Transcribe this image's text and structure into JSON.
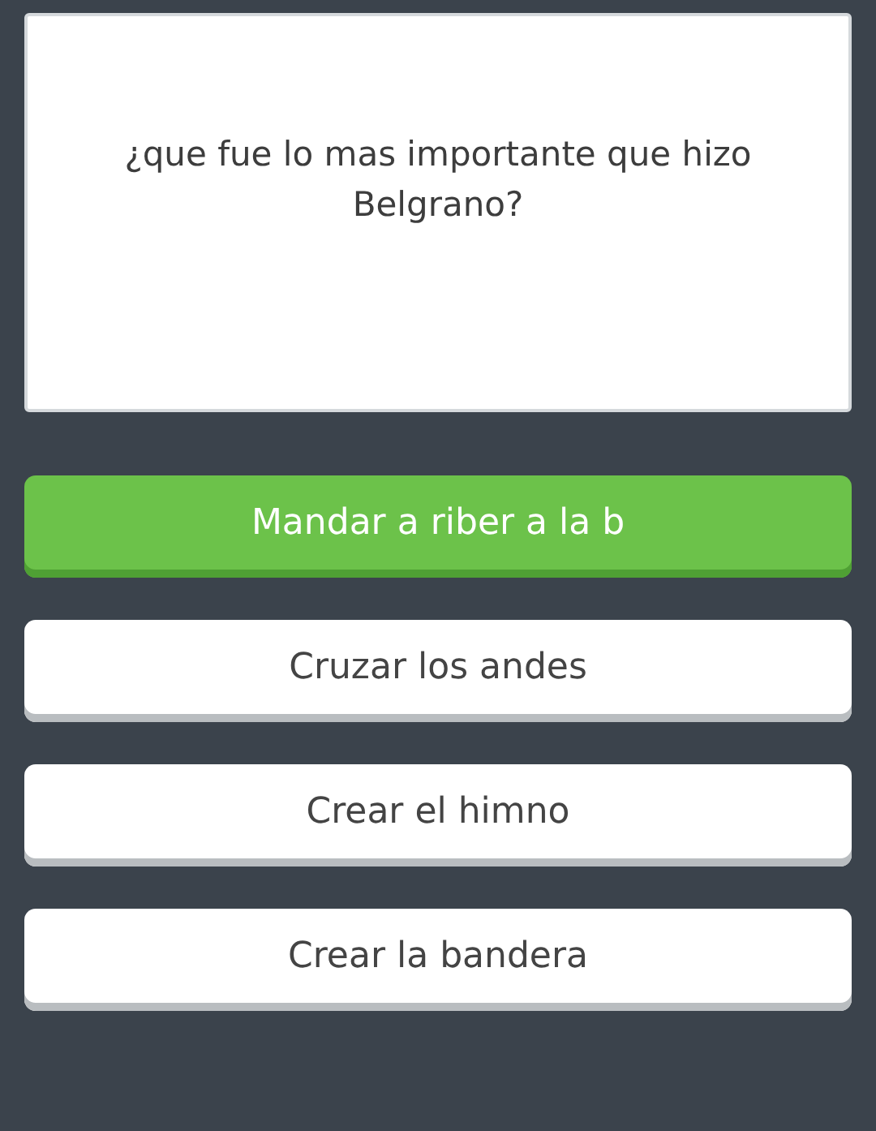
{
  "question": "¿que fue lo mas importante que hizo Belgrano?",
  "answers": [
    {
      "label": "Mandar a riber a la b",
      "selected": true
    },
    {
      "label": "Cruzar los andes",
      "selected": false
    },
    {
      "label": "Crear el himno",
      "selected": false
    },
    {
      "label": "Crear la bandera",
      "selected": false
    }
  ]
}
